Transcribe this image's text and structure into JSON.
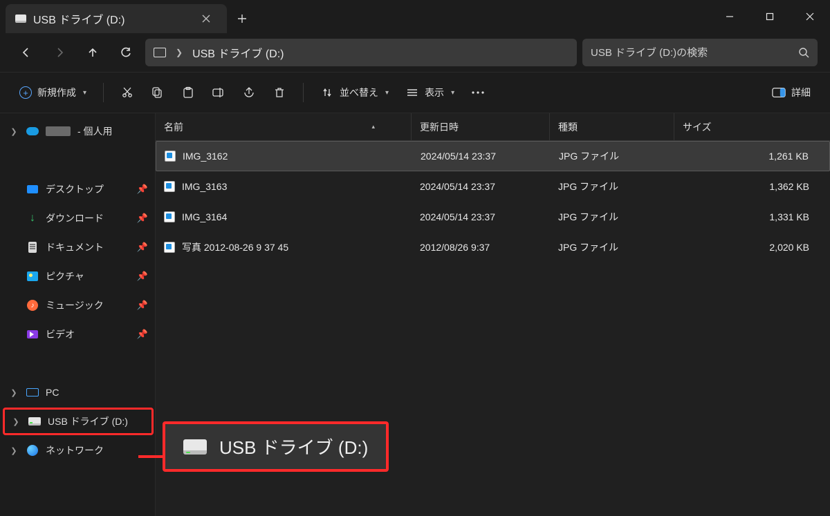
{
  "tab": {
    "title": "USB ドライブ (D:)"
  },
  "address": {
    "segments": [
      "USB ドライブ (D:)"
    ]
  },
  "search": {
    "placeholder": "USB ドライブ (D:)の検索"
  },
  "toolbar": {
    "new": "新規作成",
    "sort": "並べ替え",
    "view": "表示",
    "details": "詳細"
  },
  "sidebar": {
    "onedrive": " - 個人用",
    "quick": [
      "デスクトップ",
      "ダウンロード",
      "ドキュメント",
      "ピクチャ",
      "ミュージック",
      "ビデオ"
    ],
    "pc": "PC",
    "usb": "USB ドライブ (D:)",
    "network": "ネットワーク"
  },
  "columns": [
    "名前",
    "更新日時",
    "種類",
    "サイズ"
  ],
  "files": [
    {
      "name": "IMG_3162",
      "modified": "2024/05/14 23:37",
      "type": "JPG ファイル",
      "size": "1,261 KB",
      "selected": true
    },
    {
      "name": "IMG_3163",
      "modified": "2024/05/14 23:37",
      "type": "JPG ファイル",
      "size": "1,362 KB",
      "selected": false
    },
    {
      "name": "IMG_3164",
      "modified": "2024/05/14 23:37",
      "type": "JPG ファイル",
      "size": "1,331 KB",
      "selected": false
    },
    {
      "name": "写真 2012-08-26 9 37 45",
      "modified": "2012/08/26 9:37",
      "type": "JPG ファイル",
      "size": "2,020 KB",
      "selected": false
    }
  ],
  "callout": {
    "text": "USB ドライブ (D:)"
  }
}
